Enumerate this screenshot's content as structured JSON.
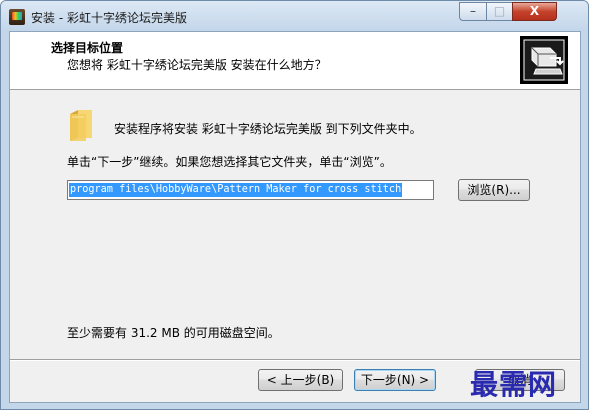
{
  "window": {
    "title": "安装 - 彩虹十字绣论坛完美版",
    "controls": {
      "minimize": "–",
      "maximize": "□",
      "close": "X"
    }
  },
  "header": {
    "title": "选择目标位置",
    "subtitle": "您想将 彩虹十字绣论坛完美版 安装在什么地方？"
  },
  "body": {
    "info": "安装程序将安装 彩虹十字绣论坛完美版 到下列文件夹中。",
    "instruction": "单击“下一步”继续。如果您想选择其它文件夹，单击“浏览”。",
    "path_value": "program files\\HobbyWare\\Pattern Maker for cross stitch",
    "browse_label": "浏览(R)...",
    "space_required": "至少需要有 31.2 MB 的可用磁盘空间。"
  },
  "footer": {
    "back_label": "< 上一步(B)",
    "next_label": "下一步(N) >",
    "cancel_label": "取消"
  },
  "watermark": "最需网",
  "icons": {
    "app": "app-icon",
    "header": "computer-install-icon",
    "folder": "folder-icon"
  },
  "colors": {
    "frame": "#c3d6ea",
    "selection": "#3399ff",
    "close_button": "#c5432b",
    "watermark": "#2a2ab0"
  }
}
